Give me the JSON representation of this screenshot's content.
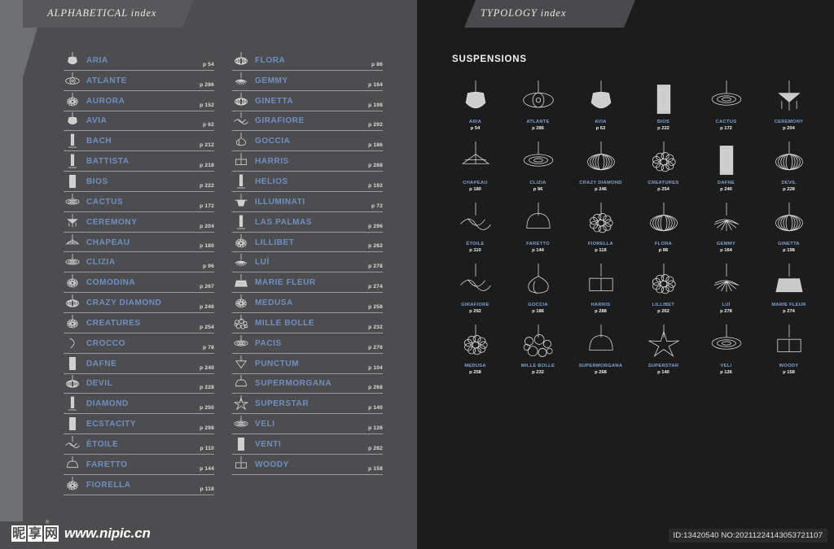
{
  "left_page": {
    "tab_label": "ALPHABETICAL index",
    "columns": [
      {
        "entries": [
          {
            "name": "ARIA",
            "page": "p 54",
            "icon": "pendant-aria-icon"
          },
          {
            "name": "ATLANTE",
            "page": "p 286",
            "icon": "pendant-atlante-icon"
          },
          {
            "name": "AURORA",
            "page": "p 152",
            "icon": "pendant-aurora-icon"
          },
          {
            "name": "AVIA",
            "page": "p 62",
            "icon": "pendant-avia-icon"
          },
          {
            "name": "BACH",
            "page": "p 212",
            "icon": "floor-bach-icon"
          },
          {
            "name": "BATTISTA",
            "page": "p 218",
            "icon": "floor-battista-icon"
          },
          {
            "name": "BIOS",
            "page": "p 222",
            "icon": "panel-bios-icon"
          },
          {
            "name": "CACTUS",
            "page": "p 172",
            "icon": "pendant-cactus-icon"
          },
          {
            "name": "CEREMONY",
            "page": "p 204",
            "icon": "pendant-ceremony-icon"
          },
          {
            "name": "CHAPEAU",
            "page": "p 180",
            "icon": "pendant-chapeau-icon"
          },
          {
            "name": "CLIZIA",
            "page": "p 96",
            "icon": "pendant-clizia-icon"
          },
          {
            "name": "COMODINA",
            "page": "p 267",
            "icon": "table-comodina-icon"
          },
          {
            "name": "CRAZY DIAMOND",
            "page": "p 246",
            "icon": "pendant-crazy-diamond-icon"
          },
          {
            "name": "CREATURES",
            "page": "p 254",
            "icon": "pendant-creatures-icon"
          },
          {
            "name": "CROCCO",
            "page": "p 78",
            "icon": "wall-crocco-icon"
          },
          {
            "name": "DAFNE",
            "page": "p 240",
            "icon": "panel-dafne-icon"
          },
          {
            "name": "DEVIL",
            "page": "p 228",
            "icon": "pendant-devil-icon"
          },
          {
            "name": "DIAMOND",
            "page": "p 250",
            "icon": "floor-diamond-icon"
          },
          {
            "name": "ECSTACITY",
            "page": "p 298",
            "icon": "panel-ecstacity-icon"
          },
          {
            "name": "ÉTOILE",
            "page": "p 110",
            "icon": "pendant-etoile-icon"
          },
          {
            "name": "FARETTO",
            "page": "p 144",
            "icon": "pendant-faretto-icon"
          },
          {
            "name": "FIORELLA",
            "page": "p 118",
            "icon": "pendant-fiorella-icon"
          }
        ]
      },
      {
        "entries": [
          {
            "name": "FLORA",
            "page": "p 86",
            "icon": "pendant-flora-icon"
          },
          {
            "name": "GEMMY",
            "page": "p 164",
            "icon": "pendant-gemmy-icon"
          },
          {
            "name": "GINETTA",
            "page": "p 198",
            "icon": "pendant-ginetta-icon"
          },
          {
            "name": "GIRAFIORE",
            "page": "p 292",
            "icon": "pendant-girafiore-icon"
          },
          {
            "name": "GOCCIA",
            "page": "p 186",
            "icon": "pendant-goccia-icon"
          },
          {
            "name": "HARRIS",
            "page": "p 288",
            "icon": "pendant-harris-icon"
          },
          {
            "name": "HELIOS",
            "page": "p 192",
            "icon": "linear-helios-icon"
          },
          {
            "name": "ILLUMINATI",
            "page": "p 72",
            "icon": "pendant-illuminati-icon"
          },
          {
            "name": "LAS PALMAS",
            "page": "p 296",
            "icon": "floor-las-palmas-icon"
          },
          {
            "name": "LILLIBET",
            "page": "p 262",
            "icon": "pendant-lillibet-icon"
          },
          {
            "name": "LUÌ",
            "page": "p 278",
            "icon": "pendant-lui-icon"
          },
          {
            "name": "MARIE FLEUR",
            "page": "p 274",
            "icon": "pendant-marie-fleur-icon"
          },
          {
            "name": "MEDUSA",
            "page": "p 258",
            "icon": "pendant-medusa-icon"
          },
          {
            "name": "MILLE BOLLE",
            "page": "p 232",
            "icon": "pendant-mille-bolle-icon"
          },
          {
            "name": "PACIS",
            "page": "p 276",
            "icon": "ceiling-pacis-icon"
          },
          {
            "name": "PUNCTUM",
            "page": "p 104",
            "icon": "pendant-punctum-icon"
          },
          {
            "name": "SUPERMORGANA",
            "page": "p 268",
            "icon": "pendant-supermorgana-icon"
          },
          {
            "name": "SUPERSTAR",
            "page": "p 140",
            "icon": "pendant-superstar-icon"
          },
          {
            "name": "VELI",
            "page": "p 126",
            "icon": "ceiling-veli-icon"
          },
          {
            "name": "VENTI",
            "page": "p 282",
            "icon": "panel-venti-icon"
          },
          {
            "name": "WOODY",
            "page": "p 158",
            "icon": "wall-woody-icon"
          }
        ]
      }
    ]
  },
  "right_page": {
    "tab_label": "TYPOLOGY index",
    "section_title": "SUSPENSIONS",
    "items": [
      {
        "name": "ARIA",
        "page": "p 54",
        "icon": "pendant-aria-icon"
      },
      {
        "name": "ATLANTE",
        "page": "p 286",
        "icon": "pendant-atlante-icon"
      },
      {
        "name": "AVIA",
        "page": "p 62",
        "icon": "pendant-avia-icon"
      },
      {
        "name": "BIOS",
        "page": "p 222",
        "icon": "pendant-bios-icon"
      },
      {
        "name": "CACTUS",
        "page": "p 172",
        "icon": "pendant-cactus-icon"
      },
      {
        "name": "CEREMONY",
        "page": "p 204",
        "icon": "pendant-ceremony-icon"
      },
      {
        "name": "CHAPEAU",
        "page": "p 180",
        "icon": "pendant-chapeau-icon"
      },
      {
        "name": "CLIZIA",
        "page": "p 96",
        "icon": "pendant-clizia-icon"
      },
      {
        "name": "CRAZY DIAMOND",
        "page": "p 246",
        "icon": "pendant-crazy-diamond-icon"
      },
      {
        "name": "CREATURES",
        "page": "p 254",
        "icon": "pendant-creatures-icon"
      },
      {
        "name": "DAFNE",
        "page": "p 240",
        "icon": "pendant-dafne-icon"
      },
      {
        "name": "DEVIL",
        "page": "p 228",
        "icon": "pendant-devil-icon"
      },
      {
        "name": "ÉTOILE",
        "page": "p 110",
        "icon": "pendant-etoile-icon"
      },
      {
        "name": "FARETTO",
        "page": "p 144",
        "icon": "pendant-faretto-icon"
      },
      {
        "name": "FIORELLA",
        "page": "p 118",
        "icon": "pendant-fiorella-icon"
      },
      {
        "name": "FLORA",
        "page": "p 86",
        "icon": "pendant-flora-icon"
      },
      {
        "name": "GEMMY",
        "page": "p 164",
        "icon": "pendant-gemmy-icon"
      },
      {
        "name": "GINETTA",
        "page": "p 198",
        "icon": "pendant-ginetta-icon"
      },
      {
        "name": "GIRAFIORE",
        "page": "p 292",
        "icon": "pendant-girafiore-icon"
      },
      {
        "name": "GOCCIA",
        "page": "p 186",
        "icon": "pendant-goccia-icon"
      },
      {
        "name": "HARRIS",
        "page": "p 288",
        "icon": "pendant-harris-icon"
      },
      {
        "name": "LILLIBET",
        "page": "p 262",
        "icon": "pendant-lillibet-icon"
      },
      {
        "name": "LUÌ",
        "page": "p 278",
        "icon": "pendant-lui-icon"
      },
      {
        "name": "MARIE FLEUR",
        "page": "p 274",
        "icon": "pendant-marie-fleur-icon"
      },
      {
        "name": "MEDUSA",
        "page": "p 258",
        "icon": "pendant-medusa-icon"
      },
      {
        "name": "MILLE BOLLE",
        "page": "p 232",
        "icon": "pendant-mille-bolle-icon"
      },
      {
        "name": "SUPERMORGANA",
        "page": "p 268",
        "icon": "pendant-supermorgana-icon"
      },
      {
        "name": "SUPERSTAR",
        "page": "p 140",
        "icon": "pendant-superstar-icon"
      },
      {
        "name": "VELI",
        "page": "p 126",
        "icon": "pendant-veli-icon"
      },
      {
        "name": "WOODY",
        "page": "p 158",
        "icon": "pendant-woody-icon"
      }
    ]
  },
  "footer": {
    "watermark_logo_chars": [
      "昵",
      "享",
      "网"
    ],
    "watermark_registered": "®",
    "watermark_url": "www.nipic.cn",
    "id_text": "ID:13420540 NO:20211224143053721107"
  },
  "colors": {
    "left_page_bg": "#4d4d4f",
    "right_page_bg": "#1c1c1d",
    "edge_strip": "#6e7073",
    "tab_bg": "#58585a",
    "entry_name": "#6f8fc4",
    "entry_page": "#dedede",
    "separator": "#9a9b9d",
    "grid_name": "#7fa0d2"
  }
}
